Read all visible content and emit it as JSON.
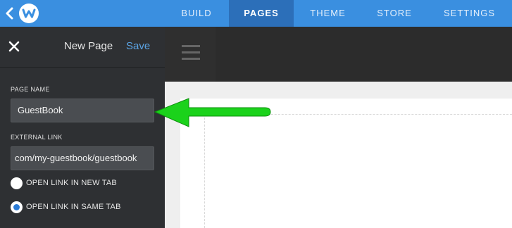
{
  "topbar": {
    "tabs": [
      {
        "label": "BUILD"
      },
      {
        "label": "PAGES"
      },
      {
        "label": "THEME"
      },
      {
        "label": "STORE"
      },
      {
        "label": "SETTINGS"
      }
    ],
    "active_tab": "PAGES",
    "accent_color": "#3a8fe0",
    "active_color": "#2c6fb9"
  },
  "panel": {
    "title": "New Page",
    "save_label": "Save",
    "page_name_label": "PAGE NAME",
    "page_name_value": "GuestBook",
    "external_link_label": "EXTERNAL LINK",
    "external_link_value": "com/my-guestbook/guestbook",
    "options": [
      {
        "label": "OPEN LINK IN NEW TAB",
        "checked": false
      },
      {
        "label": "OPEN LINK IN SAME TAB",
        "checked": true
      }
    ]
  },
  "annotation": {
    "arrow_color": "#1bd21b",
    "points_to": "page-name-field"
  }
}
